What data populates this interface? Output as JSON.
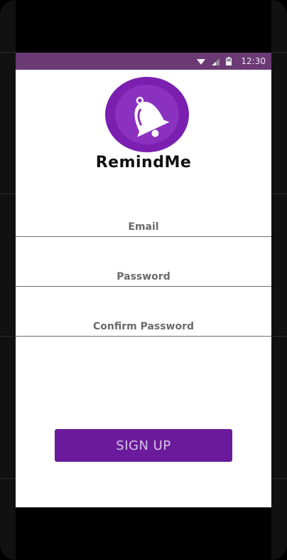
{
  "status_bar": {
    "time": "12:30",
    "background": "#6b3a74",
    "icons": [
      "wifi-icon",
      "signal-icon",
      "battery-icon"
    ]
  },
  "app": {
    "name": "RemindMe",
    "logo_icon": "bell-icon",
    "logo_color": "#7a1fb0"
  },
  "form": {
    "email_placeholder": "Email",
    "password_placeholder": "Password",
    "confirm_password_placeholder": "Confirm Password",
    "submit_label": "SIGN UP",
    "submit_color": "#6a1a9a"
  }
}
